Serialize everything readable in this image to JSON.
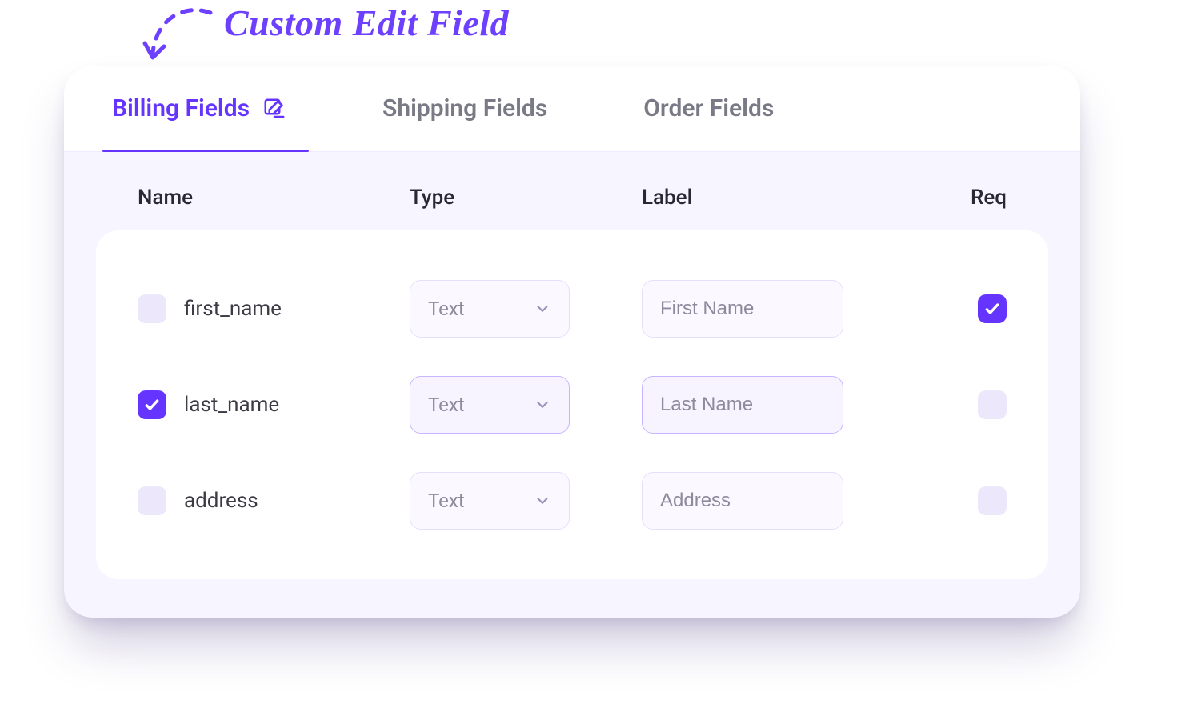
{
  "annotation": {
    "text": "Custom Edit Field"
  },
  "tabs": [
    {
      "key": "billing",
      "label": "Billing Fields",
      "active": true,
      "hasEditIcon": true
    },
    {
      "key": "shipping",
      "label": "Shipping Fields",
      "active": false,
      "hasEditIcon": false
    },
    {
      "key": "order",
      "label": "Order Fields",
      "active": false,
      "hasEditIcon": false
    }
  ],
  "columns": {
    "name": "Name",
    "type": "Type",
    "label": "Label",
    "req": "Req"
  },
  "rows": [
    {
      "selected": false,
      "name": "first_name",
      "type": "Text",
      "label_placeholder": "First Name",
      "required": true,
      "highlight": false
    },
    {
      "selected": true,
      "name": "last_name",
      "type": "Text",
      "label_placeholder": "Last Name",
      "required": false,
      "highlight": true
    },
    {
      "selected": false,
      "name": "address",
      "type": "Text",
      "label_placeholder": "Address",
      "required": false,
      "highlight": false
    }
  ],
  "colors": {
    "accent": "#6534ff"
  }
}
